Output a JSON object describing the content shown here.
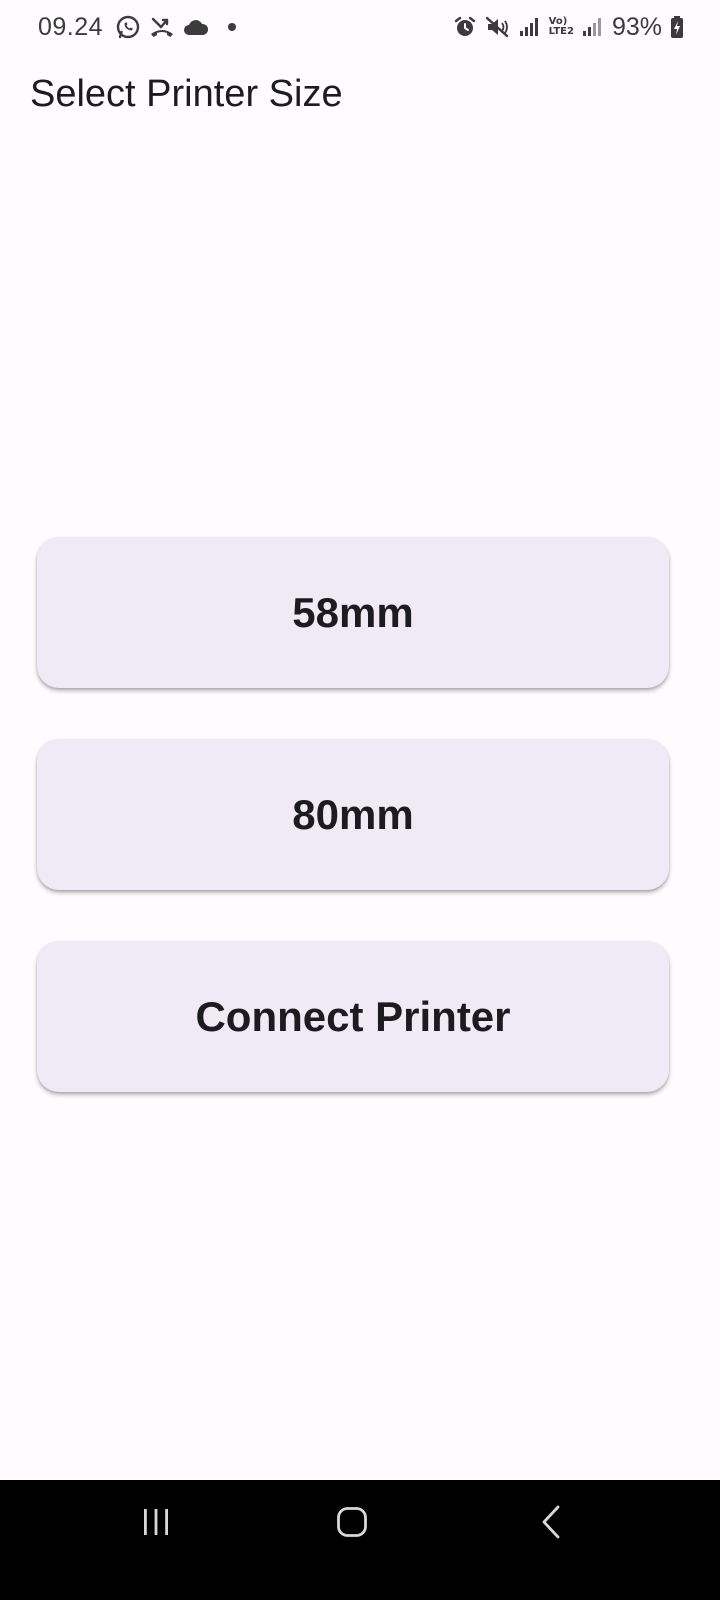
{
  "status_bar": {
    "time": "09.24",
    "battery_percent": "93%",
    "lte_top": "Vo)",
    "lte_bottom": "LTE2",
    "icons": [
      "whatsapp-icon",
      "missed-call-icon",
      "cloud-icon",
      "dot-icon",
      "alarm-icon",
      "mute-icon",
      "signal-icon",
      "signal-icon-2",
      "battery-charging-icon"
    ]
  },
  "app_bar": {
    "title": "Select Printer Size"
  },
  "buttons": {
    "size_58": "58mm",
    "size_80": "80mm",
    "connect": "Connect Printer"
  },
  "nav_bar": {
    "icons": [
      "recents-icon",
      "home-icon",
      "back-icon"
    ]
  },
  "colors": {
    "background": "#fffbfe",
    "button_background": "#f0eaf6",
    "text": "#1c1b1f",
    "nav_bar": "#000000"
  }
}
